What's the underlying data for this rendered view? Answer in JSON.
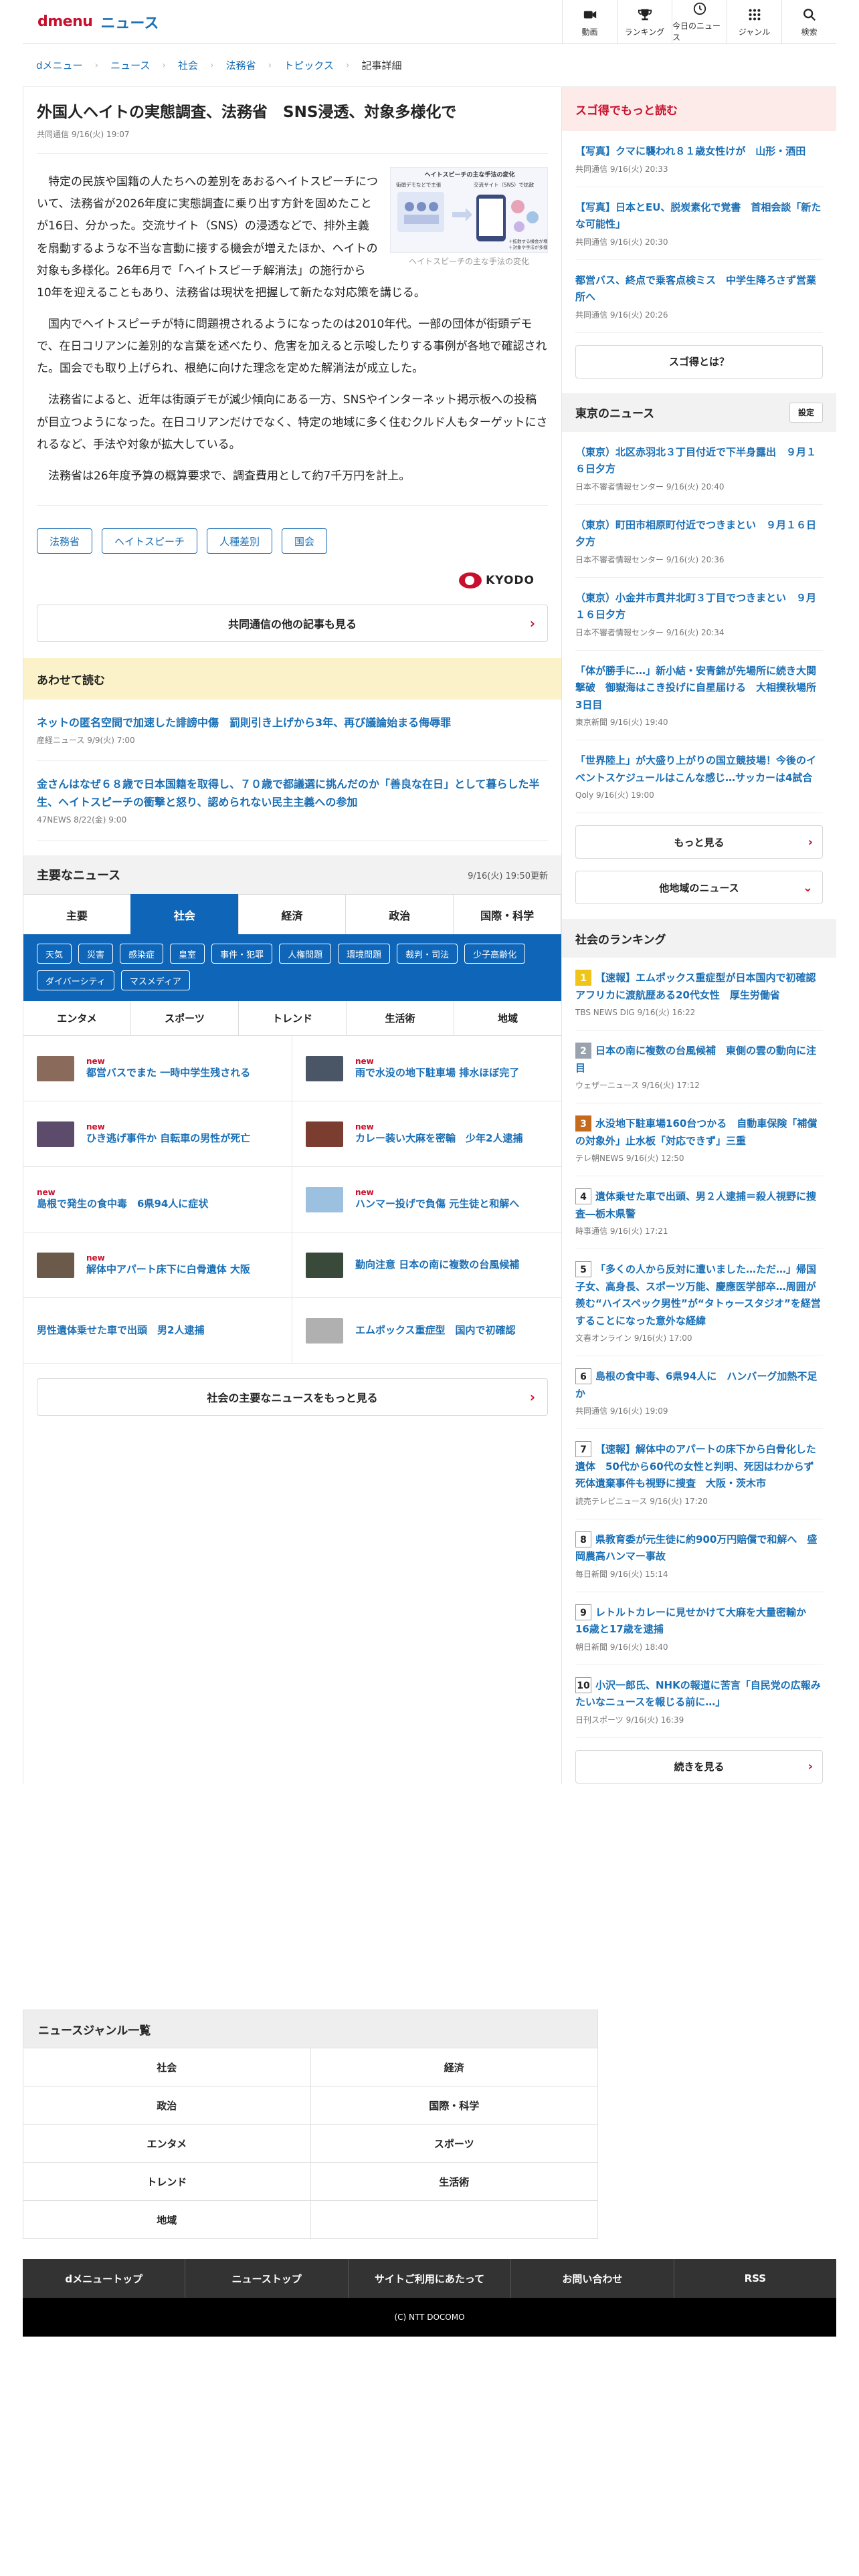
{
  "header": {
    "logo_d": "dmenu",
    "logo_news": "ニュース",
    "nav": [
      {
        "label": "動画",
        "icon": "video-icon"
      },
      {
        "label": "ランキング",
        "icon": "trophy-icon"
      },
      {
        "label": "今日のニュース",
        "icon": "clock-icon"
      },
      {
        "label": "ジャンル",
        "icon": "grid-icon"
      },
      {
        "label": "検索",
        "icon": "search-icon"
      }
    ]
  },
  "breadcrumb": [
    "dメニュー",
    "ニュース",
    "社会",
    "法務省",
    "トピックス",
    "記事詳細"
  ],
  "article": {
    "title": "外国人ヘイトの実態調査、法務省　SNS浸透、対象多様化で",
    "meta": "共同通信 9/16(火) 19:07",
    "figure_caption": "ヘイトスピーチの主な手法の変化",
    "figure_labels": {
      "title": "ヘイトスピーチの主な手法の変化",
      "left": "街頭デモなどで主張",
      "right": "交流サイト（SNS）で拡散",
      "right_note1": "＋対象や手法が多様化",
      "right_note2": "＋拡散する機会が増加"
    },
    "paragraphs": [
      "特定の民族や国籍の人たちへの差別をあおるヘイトスピーチについて、法務省が2026年度に実態調査に乗り出す方針を固めたことが16日、分かった。交流サイト（SNS）の浸透などで、排外主義を扇動するような不当な言動に接する機会が増えたほか、ヘイトの対象も多様化。26年6月で「ヘイトスピーチ解消法」の施行から10年を迎えることもあり、法務省は現状を把握して新たな対応策を講じる。",
      "国内でヘイトスピーチが特に問題視されるようになったのは2010年代。一部の団体が街頭デモで、在日コリアンに差別的な言葉を述べたり、危害を加えると示唆したりする事例が各地で確認された。国会でも取り上げられ、根絶に向けた理念を定めた解消法が成立した。",
      "法務省によると、近年は街頭デモが減少傾向にある一方、SNSやインターネット掲示板への投稿が目立つようになった。在日コリアンだけでなく、特定の地域に多く住むクルド人もターゲットにされるなど、手法や対象が拡大している。",
      "法務省は26年度予算の概算要求で、調査費用として約7千万円を計上。"
    ],
    "tags": [
      "法務省",
      "ヘイトスピーチ",
      "人種差別",
      "国会"
    ],
    "provider": "KYODO",
    "more_button": "共同通信の他の記事も見る"
  },
  "awase": {
    "heading": "あわせて読む",
    "items": [
      {
        "title": "ネットの匿名空間で加速した誹謗中傷　罰則引き上げから3年、再び議論始まる侮辱罪",
        "meta": "産経ニュース 9/9(火) 7:00"
      },
      {
        "title": "金さんはなぜ６８歳で日本国籍を取得し、７０歳で都議選に挑んだのか「善良な在日」として暮らした半生、ヘイトスピーチの衝撃と怒り、認められない民主主義への参加",
        "meta": "47NEWS 8/22(金) 9:00"
      }
    ]
  },
  "main_news": {
    "heading": "主要なニュース",
    "updated": "9/16(火) 19:50更新",
    "tabs": [
      "主要",
      "社会",
      "経済",
      "政治",
      "国際・科学"
    ],
    "active_tab": 1,
    "chips": [
      "天気",
      "災害",
      "感染症",
      "皇室",
      "事件・犯罪",
      "人権問題",
      "環境問題",
      "裁判・司法",
      "少子高齢化",
      "ダイバーシティ",
      "マスメディア"
    ],
    "tabs2": [
      "エンタメ",
      "スポーツ",
      "トレンド",
      "生活術",
      "地域"
    ],
    "items": [
      {
        "new": "new",
        "title": "都営バスでまた 一時中学生残される",
        "thumb": "#8a6a5a"
      },
      {
        "new": "new",
        "title": "雨で水没の地下駐車場 排水ほぼ完了",
        "thumb": "#4a5566"
      },
      {
        "new": "new",
        "title": "ひき逃げ事件か 自転車の男性が死亡",
        "thumb": "#5d4b6b"
      },
      {
        "new": "new",
        "title": "カレー装い大麻を密輸　少年2人逮捕",
        "thumb": "#7a3d2f"
      },
      {
        "new": "new",
        "title": "島根で発生の食中毒　6県94人に症状",
        "thumb": ""
      },
      {
        "new": "new",
        "title": "ハンマー投げで負傷 元生徒と和解へ",
        "thumb": "#9cc0e0"
      },
      {
        "new": "new",
        "title": "解体中アパート床下に白骨遺体 大阪",
        "thumb": "#6b5a4a"
      },
      {
        "new": "",
        "title": "勤向注意 日本の南に複数の台風候補",
        "thumb": "#3a4a3a"
      },
      {
        "new": "",
        "title": "男性遺体乗せた車で出頭　男2人逮捕",
        "thumb": ""
      },
      {
        "new": "",
        "title": "エムポックス重症型　国内で初確認",
        "thumb": "#b0b0b0"
      }
    ],
    "more_button": "社会の主要なニュースをもっと見る"
  },
  "sidebar": {
    "sugotoku_heading": "スゴ得でもっと読む",
    "sugotoku_items": [
      {
        "title": "【写真】クマに襲われ８１歳女性けが　山形・酒田",
        "meta": "共同通信 9/16(火) 20:33"
      },
      {
        "title": "【写真】日本とEU、脱炭素化で覚書　首相会談「新たな可能性」",
        "meta": "共同通信 9/16(火) 20:30"
      },
      {
        "title": "都営バス、終点で乗客点検ミス　中学生降ろさず営業所へ",
        "meta": "共同通信 9/16(火) 20:26"
      }
    ],
    "sugotoku_button": "スゴ得とは？",
    "tokyo_heading": "東京のニュース",
    "tokyo_setting": "設定",
    "tokyo_items": [
      {
        "title": "（東京）北区赤羽北３丁目付近で下半身露出　９月１６日夕方",
        "meta": "日本不審者情報センター 9/16(火) 20:40"
      },
      {
        "title": "（東京）町田市相原町付近でつきまとい　９月１６日夕方",
        "meta": "日本不審者情報センター 9/16(火) 20:36"
      },
      {
        "title": "（東京）小金井市貫井北町３丁目でつきまとい　９月１６日夕方",
        "meta": "日本不審者情報センター 9/16(火) 20:34"
      },
      {
        "title": "「体が勝手に…」新小結・安青錦が先場所に続き大関撃破　御嶽海はこき投げに自星届ける　大相撲秋場所3日目",
        "meta": "東京新聞 9/16(火) 19:40"
      },
      {
        "title": "「世界陸上」が大盛り上がりの国立競技場！今後のイベントスケジュールはこんな感じ…サッカーは4試合",
        "meta": "Qoly 9/16(火) 19:00"
      }
    ],
    "tokyo_more": "もっと見る",
    "other_region": "他地域のニュース",
    "ranking_heading": "社会のランキング",
    "ranking": [
      {
        "n": "1",
        "title": "【速報】エムポックス重症型が日本国内で初確認　アフリカに渡航歴ある20代女性　厚生労働省",
        "meta": "TBS NEWS DIG 9/16(火) 16:22"
      },
      {
        "n": "2",
        "title": "日本の南に複数の台風候補　東側の雲の動向に注目",
        "meta": "ウェザーニュース 9/16(火) 17:12"
      },
      {
        "n": "3",
        "title": "水没地下駐車場160台つかる　自動車保険「補償の対象外」止水板「対応できず」三重",
        "meta": "テレ朝NEWS 9/16(火) 12:50"
      },
      {
        "n": "4",
        "title": "遺体乗せた車で出頭、男２人逮捕＝殺人視野に捜査―栃木県警",
        "meta": "時事通信 9/16(火) 17:21"
      },
      {
        "n": "5",
        "title": "「多くの人から反対に遭いました…ただ…」帰国子女、高身長、スポーツ万能、慶應医学部卒…周囲が羨む“ハイスペック男性”が“タトゥースタジオ”を経営することになった意外な経緯",
        "meta": "文春オンライン 9/16(火) 17:00"
      },
      {
        "n": "6",
        "title": "島根の食中毒、6県94人に　ハンバーグ加熱不足か",
        "meta": "共同通信 9/16(火) 19:09"
      },
      {
        "n": "7",
        "title": "【速報】解体中のアパートの床下から白骨化した遺体　50代から60代の女性と判明、死因はわからず　死体遺棄事件も視野に捜査　大阪・茨木市",
        "meta": "読売テレビニュース 9/16(火) 17:20"
      },
      {
        "n": "8",
        "title": "県教育委が元生徒に約900万円賠償で和解へ　盛岡農高ハンマー事故",
        "meta": "毎日新聞 9/16(火) 15:14"
      },
      {
        "n": "9",
        "title": "レトルトカレーに見せかけて大麻を大量密輸か　16歳と17歳を逮捕",
        "meta": "朝日新聞 9/16(火) 18:40"
      },
      {
        "n": "10",
        "title": "小沢一郎氏、NHKの報道に苦言「自民党の広報みたいなニュースを報じる前に…」",
        "meta": "日刊スポーツ 9/16(火) 16:39"
      }
    ],
    "ranking_more": "続きを見る"
  },
  "genre": {
    "heading": "ニュースジャンル一覧",
    "items": [
      "社会",
      "経済",
      "政治",
      "国際・科学",
      "エンタメ",
      "スポーツ",
      "トレンド",
      "生活術",
      "地域",
      ""
    ]
  },
  "footer": {
    "nav": [
      "dメニュートップ",
      "ニューストップ",
      "サイトご利用にあたって",
      "お問い合わせ",
      "RSS"
    ],
    "copyright": "(C) NTT DOCOMO"
  },
  "colors": {
    "brand_red": "#c8102e",
    "link_blue": "#1a6fb5",
    "tab_blue": "#0f66b8"
  }
}
